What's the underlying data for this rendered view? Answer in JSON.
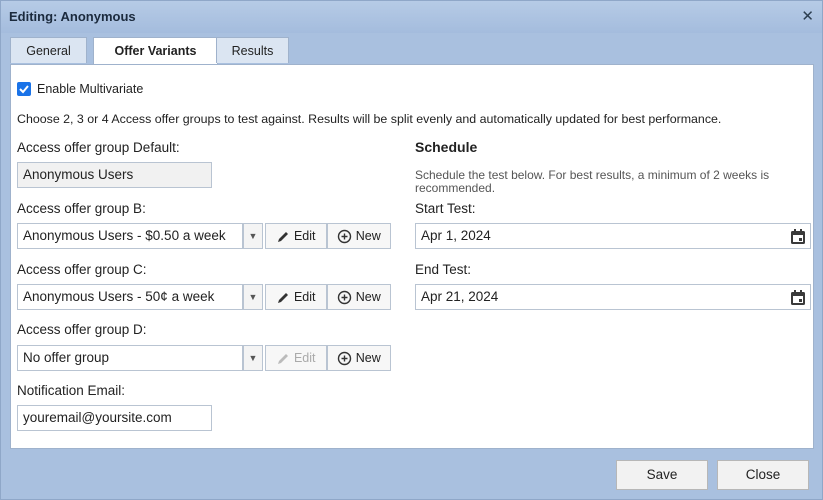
{
  "dialog": {
    "title": "Editing: Anonymous",
    "close_glyph": "✕"
  },
  "tabs": [
    {
      "label": "General",
      "active": false
    },
    {
      "label": "Offer Variants",
      "active": true
    },
    {
      "label": "Results",
      "active": false
    }
  ],
  "multivariate": {
    "checkbox_label": "Enable Multivariate",
    "checked": true,
    "description": "Choose 2, 3 or 4 Access offer groups to test against. Results will be split evenly and automatically updated for best performance."
  },
  "groups": {
    "default": {
      "label": "Access offer group Default:",
      "value": "Anonymous Users"
    },
    "b": {
      "label": "Access offer group B:",
      "value": "Anonymous Users - $0.50 a week"
    },
    "c": {
      "label": "Access offer group C:",
      "value": "Anonymous Users - 50¢ a week"
    },
    "d": {
      "label": "Access offer group D:",
      "value": "No offer group"
    },
    "edit_label": "Edit",
    "new_label": "New"
  },
  "notification": {
    "label": "Notification Email:",
    "value": "youremail@yoursite.com"
  },
  "schedule": {
    "heading": "Schedule",
    "help": "Schedule the test below. For best results, a minimum of 2 weeks is recommended.",
    "start_label": "Start Test:",
    "start_value": "Apr 1, 2024",
    "end_label": "End Test:",
    "end_value": "Apr 21, 2024"
  },
  "footer": {
    "save_label": "Save",
    "close_label": "Close"
  },
  "colors": {
    "accent": "#1a73e8",
    "frame": "#a9c0df"
  }
}
